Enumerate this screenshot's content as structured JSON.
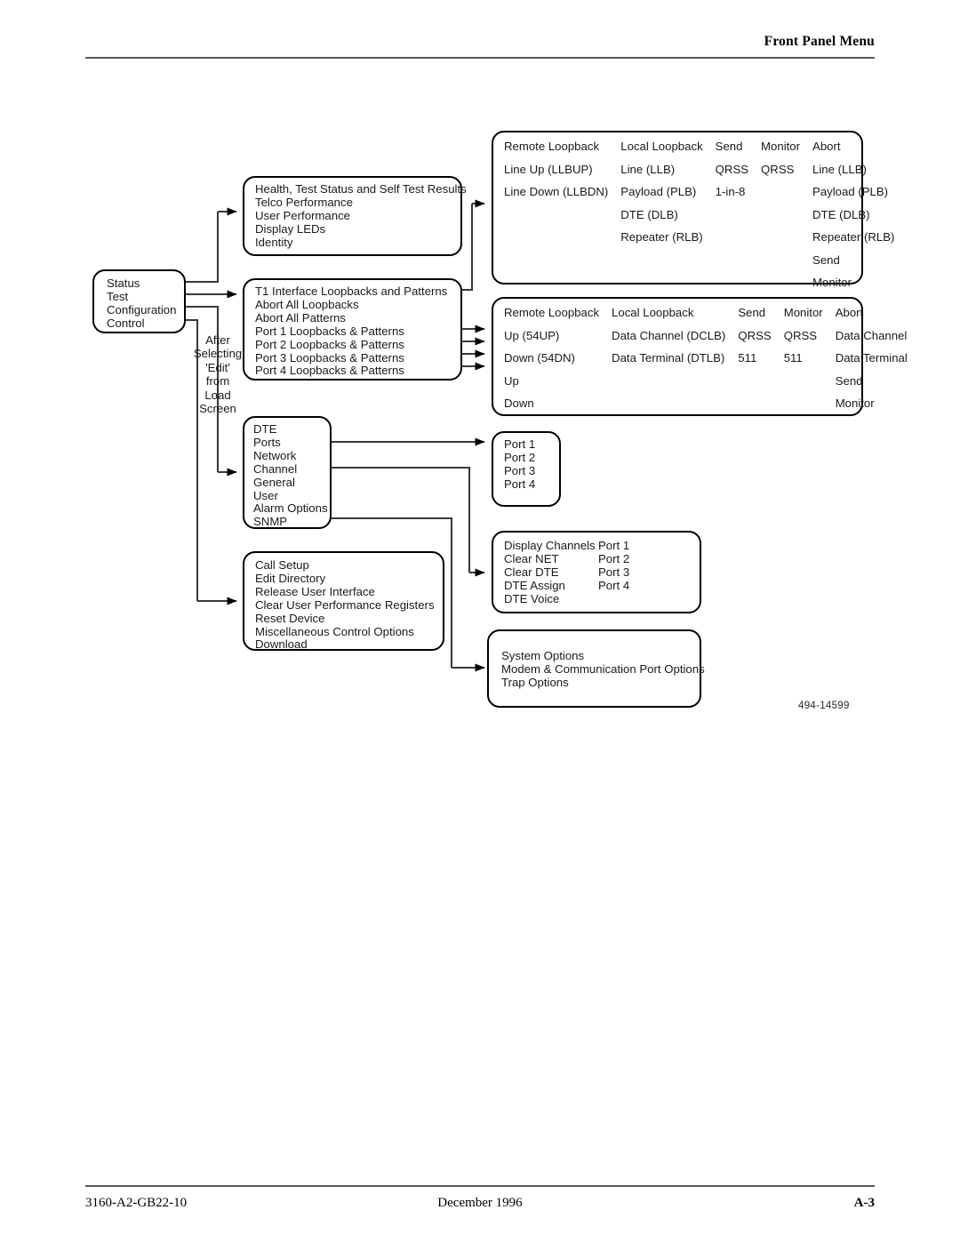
{
  "header": {
    "title": "Front Panel Menu"
  },
  "footer": {
    "doc_number": "3160-A2-GB22-10",
    "date": "December 1996",
    "page": "A-3"
  },
  "figure": {
    "id": "494-14599"
  },
  "diagram": {
    "side_note": "After\nSelecting\n'Edit'\nfrom\nLoad\nScreen",
    "side_note_lines": [
      "After",
      "Selecting",
      "'Edit'",
      "from",
      "Load",
      "Screen"
    ],
    "main_menu": {
      "name": "main-menu",
      "items": [
        "Status",
        "Test",
        "Configuration",
        "Control"
      ]
    },
    "status_box": {
      "name": "status-submenu",
      "items": [
        "Health, Test Status and Self Test Results",
        "Telco Performance",
        "User Performance",
        "Display LEDs",
        "Identity"
      ]
    },
    "test_box": {
      "name": "test-submenu",
      "items": [
        "T1 Interface Loopbacks and Patterns",
        "Abort All Loopbacks",
        "Abort All Patterns",
        "Port 1 Loopbacks & Patterns",
        "Port 2 Loopbacks & Patterns",
        "Port 3 Loopbacks & Patterns",
        "Port 4 Loopbacks & Patterns"
      ]
    },
    "configuration_box": {
      "name": "configuration-submenu",
      "items": [
        "DTE",
        "Ports",
        "Network",
        "Channel",
        "General",
        "User",
        "Alarm Options",
        "SNMP"
      ]
    },
    "control_box": {
      "name": "control-submenu",
      "items": [
        "Call Setup",
        "Edit Directory",
        "Release User Interface",
        "Clear User Performance Registers",
        "Reset Device",
        "Miscellaneous Control Options",
        "Download"
      ]
    },
    "t1_loopback_table": {
      "name": "t1-interface-loopback-table",
      "columns": [
        "Remote Loopback",
        "Local Loopback",
        "Send",
        "Monitor",
        "Abort"
      ],
      "rows": [
        [
          "Line Up (LLBUP)",
          "Line (LLB)",
          "QRSS",
          "QRSS",
          "Line (LLB)"
        ],
        [
          "Line Down (LLBDN)",
          "Payload (PLB)",
          "1-in-8",
          "",
          "Payload (PLB)"
        ],
        [
          "",
          "DTE (DLB)",
          "",
          "",
          "DTE (DLB)"
        ],
        [
          "",
          "Repeater (RLB)",
          "",
          "",
          "Repeater (RLB)"
        ],
        [
          "",
          "",
          "",
          "",
          "Send"
        ],
        [
          "",
          "",
          "",
          "",
          "Monitor"
        ]
      ]
    },
    "port_loopback_table": {
      "name": "port-loopback-table",
      "columns": [
        "Remote Loopback",
        "Local Loopback",
        "Send",
        "Monitor",
        "Abort"
      ],
      "rows": [
        [
          "Up (54UP)",
          "Data Channel (DCLB)",
          "QRSS",
          "QRSS",
          "Data Channel"
        ],
        [
          "Down (54DN)",
          "Data Terminal (DTLB)",
          "511",
          "511",
          "Data Terminal"
        ],
        [
          "Up",
          "",
          "",
          "",
          "Send"
        ],
        [
          "Down",
          "",
          "",
          "",
          "Monitor"
        ]
      ]
    },
    "ports_box": {
      "name": "ports-submenu",
      "items": [
        "Port 1",
        "Port 2",
        "Port 3",
        "Port 4"
      ]
    },
    "channel_box": {
      "name": "channel-submenu",
      "columns": [
        [
          "Display Channels",
          "Clear NET",
          "Clear DTE",
          "DTE Assign",
          "DTE Voice"
        ],
        [
          "Port 1",
          "Port 2",
          "Port 3",
          "Port 4"
        ]
      ]
    },
    "snmp_box": {
      "name": "snmp-submenu",
      "items": [
        "System Options",
        "Modem & Communication Port Options",
        "Trap Options"
      ]
    }
  }
}
